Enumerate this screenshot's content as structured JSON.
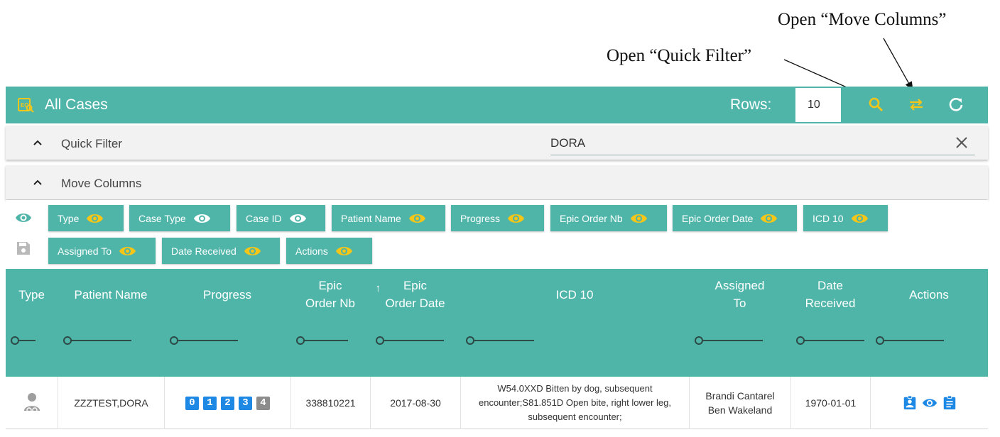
{
  "annotations": {
    "move_columns": "Open “Move Columns”",
    "quick_filter": "Open “Quick Filter”"
  },
  "toolbar": {
    "title": "All Cases",
    "rows_label": "Rows:",
    "rows_value": "10",
    "accent_color": "#f5c518",
    "bg_color": "#4fb5a8"
  },
  "quick_filter": {
    "title": "Quick Filter",
    "value": "DORA"
  },
  "move_columns": {
    "title": "Move Columns",
    "chips": [
      {
        "label": "Type",
        "eye": "yellow"
      },
      {
        "label": "Case Type",
        "eye": "white"
      },
      {
        "label": "Case ID",
        "eye": "white"
      },
      {
        "label": "Patient Name",
        "eye": "yellow"
      },
      {
        "label": "Progress",
        "eye": "yellow"
      },
      {
        "label": "Epic Order Nb",
        "eye": "yellow"
      },
      {
        "label": "Epic Order Date",
        "eye": "yellow"
      },
      {
        "label": "ICD 10",
        "eye": "yellow"
      },
      {
        "label": "Assigned To",
        "eye": "yellow"
      },
      {
        "label": "Date Received",
        "eye": "yellow"
      },
      {
        "label": "Actions",
        "eye": "yellow"
      }
    ]
  },
  "table": {
    "headers": [
      "Type",
      "Patient Name",
      "Progress",
      "Epic\nOrder Nb",
      "Epic\nOrder Date",
      "ICD 10",
      "Assigned\nTo",
      "Date\nReceived",
      "Actions"
    ],
    "sort_arrow": "↑",
    "rows": [
      {
        "type_icon": "patient-icon",
        "patient_name": "ZZZTEST,DORA",
        "progress_steps": [
          "0",
          "1",
          "2",
          "3",
          "4"
        ],
        "epic_order_nb": "338810221",
        "epic_order_date": "2017-08-30",
        "icd10": "W54.0XXD Bitten by dog, subsequent encounter;S81.851D Open bite, right lower leg, subsequent encounter;",
        "assigned_to": "Brandi Cantarel\nBen Wakeland",
        "date_received": "1970-01-01",
        "actions": [
          "assignment-ind-icon",
          "view-icon",
          "clipboard-icon"
        ]
      }
    ]
  }
}
